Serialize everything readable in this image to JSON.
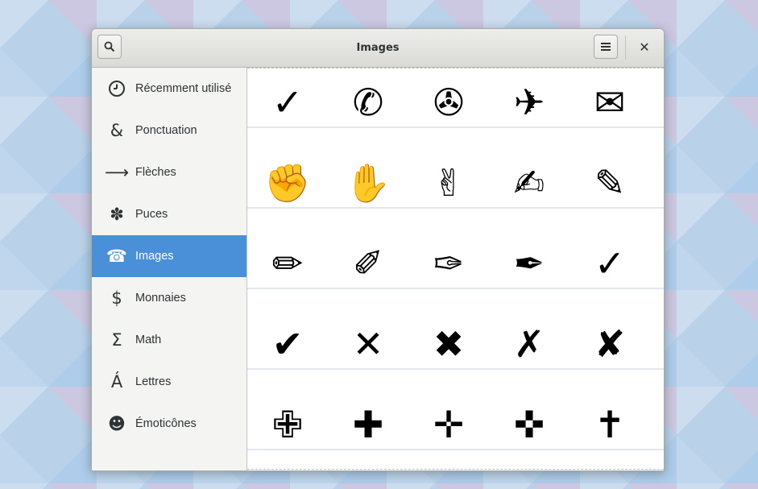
{
  "window": {
    "title": "Images"
  },
  "header": {
    "search_icon": "search-icon",
    "menu_icon": "hamburger-icon",
    "close_glyph": "✕"
  },
  "sidebar": {
    "items": [
      {
        "label": "Récemment utilisé",
        "icon": "🕓",
        "icon_name": "clock-icon",
        "active": false
      },
      {
        "label": "Ponctuation",
        "icon": "&",
        "icon_name": "ampersand-icon",
        "active": false
      },
      {
        "label": "Flèches",
        "icon": "⟶",
        "icon_name": "arrow-icon",
        "active": false
      },
      {
        "label": "Puces",
        "icon": "✽",
        "icon_name": "bullet-icon",
        "active": false
      },
      {
        "label": "Images",
        "icon": "☎",
        "icon_name": "telephone-icon",
        "active": true
      },
      {
        "label": "Monnaies",
        "icon": "$",
        "icon_name": "dollar-icon",
        "active": false
      },
      {
        "label": "Math",
        "icon": "Σ",
        "icon_name": "sigma-icon",
        "active": false
      },
      {
        "label": "Lettres",
        "icon": "Á",
        "icon_name": "letter-icon",
        "active": false
      },
      {
        "label": "Émoticônes",
        "icon": "☻",
        "icon_name": "emoticon-icon",
        "active": false
      }
    ]
  },
  "characters": {
    "rows": [
      [
        "✓",
        "✆",
        "✇",
        "✈",
        "✉"
      ],
      [
        "✊",
        "✋",
        "✌",
        "✍",
        "✎"
      ],
      [
        "✏",
        "✐",
        "✑",
        "✒",
        "✓"
      ],
      [
        "✔",
        "✕",
        "✖",
        "✗",
        "✘"
      ],
      [
        "✙",
        "✚",
        "✛",
        "✜",
        "✝"
      ]
    ]
  },
  "colors": {
    "accent": "#4a90d9",
    "sidebar_bg": "#f4f4f3",
    "headerbar_bg": "#e4e4e2"
  }
}
